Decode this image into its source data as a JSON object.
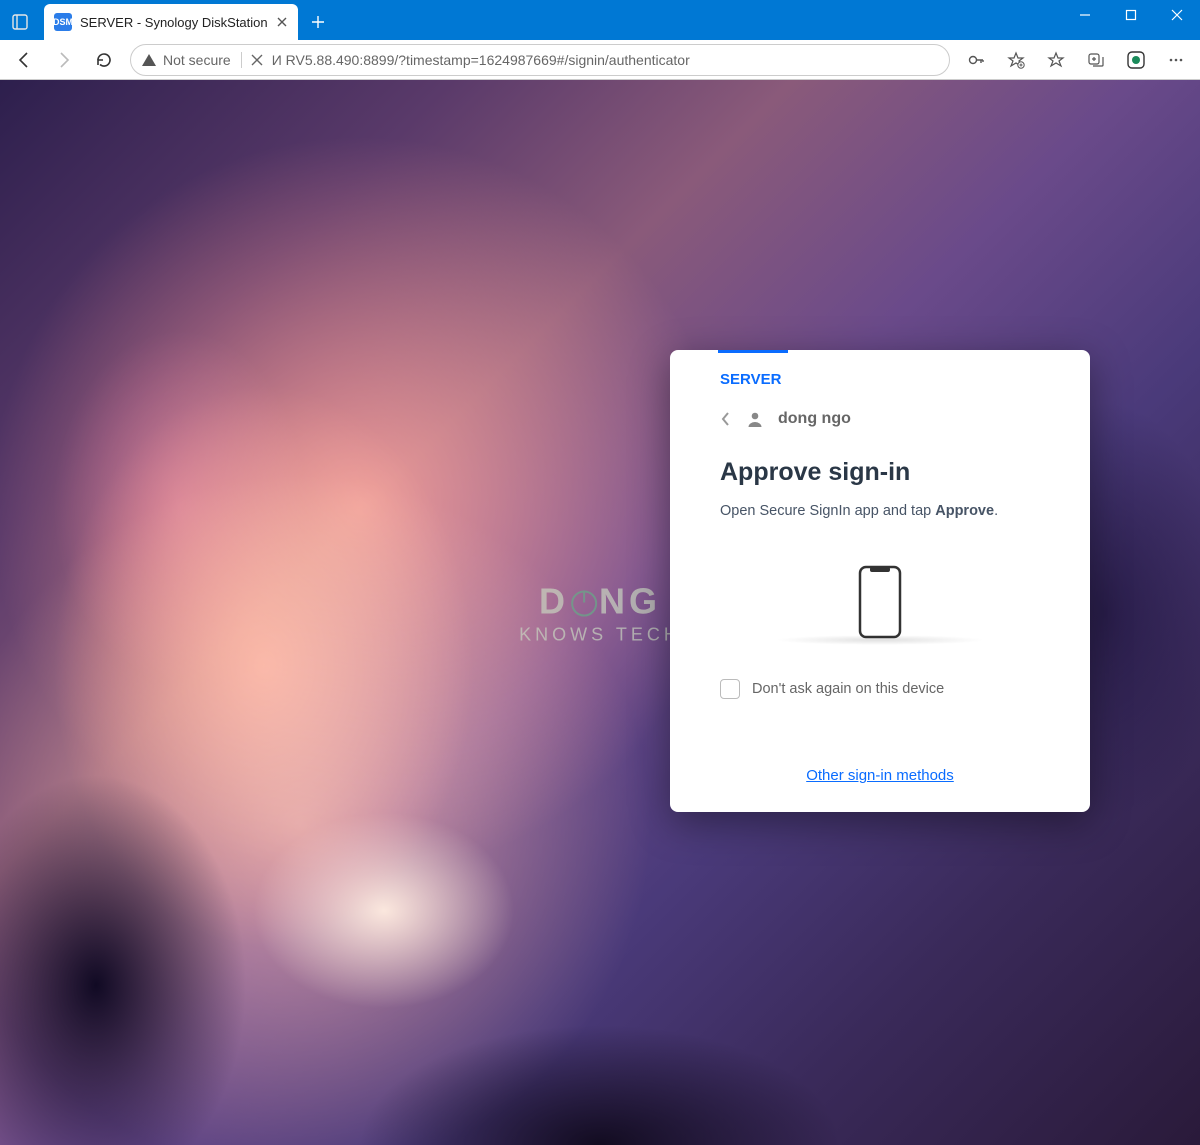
{
  "browser": {
    "tab": {
      "favicon_text": "DSM",
      "title": "SERVER - Synology DiskStation"
    },
    "security_label": "Not secure",
    "url": "И RV5.88.490:8899/?timestamp=1624987669#/signin/authenticator"
  },
  "watermark": {
    "line1_a": "D",
    "line1_b": "NG",
    "line2": "KNOWS TECH"
  },
  "card": {
    "server_name": "SERVER",
    "username": "dong ngo",
    "title": "Approve sign-in",
    "instruction_prefix": "Open Secure SignIn app and tap ",
    "instruction_bold": "Approve",
    "instruction_suffix": ".",
    "checkbox_label": "Don't ask again on this device",
    "other_link": "Other sign-in methods"
  }
}
